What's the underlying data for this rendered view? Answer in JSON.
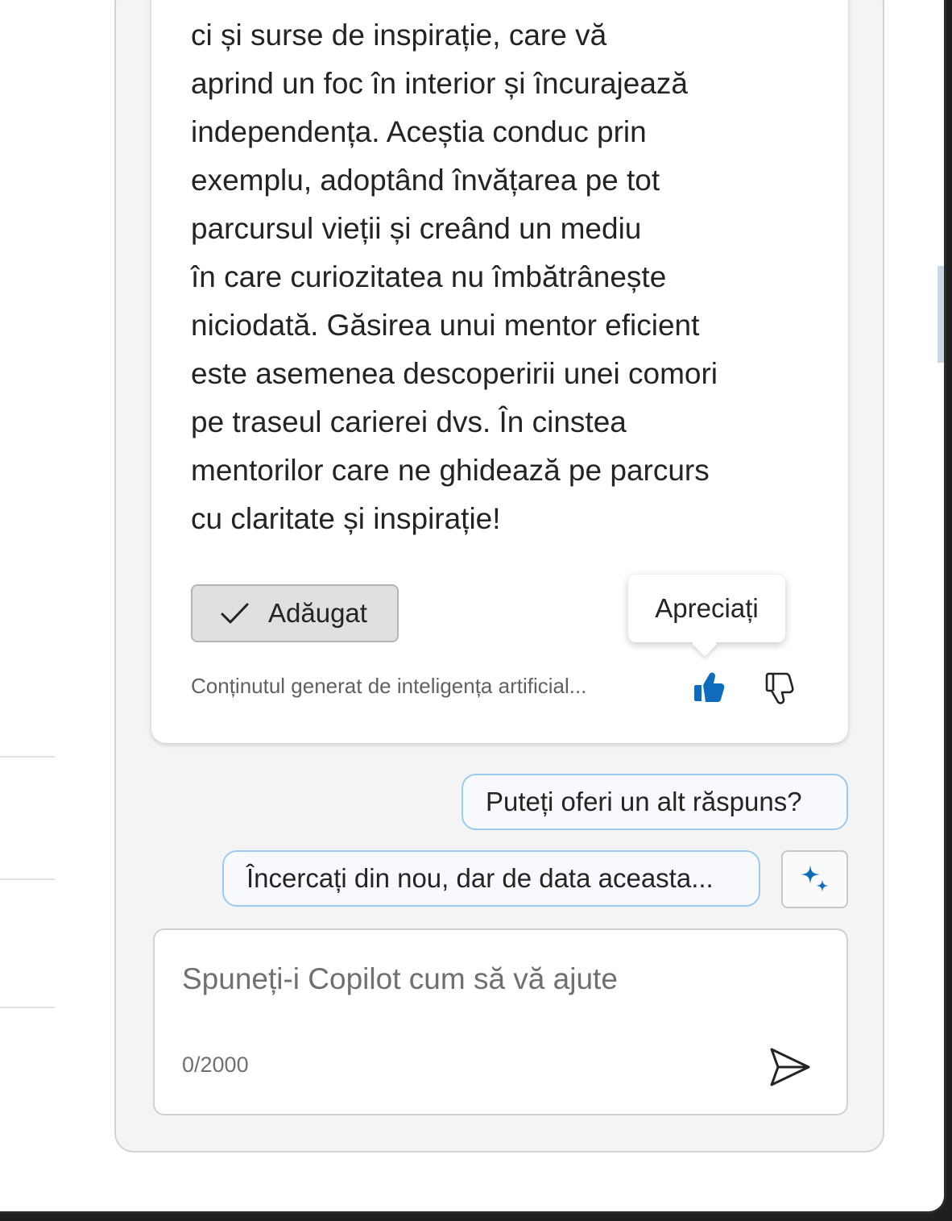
{
  "response": {
    "lines": [
      "ci și surse de inspirație, care vă",
      "aprind un foc în interior și încurajează",
      "independența. Aceștia conduc prin",
      "exemplu, adoptând învățarea pe tot",
      "parcursul vieții și creând un mediu",
      "în care curiozitatea nu îmbătrânește",
      "niciodată. Găsirea unui mentor eficient",
      "este asemenea descoperirii unei comori",
      "pe traseul carierei dvs. În cinstea",
      "mentorilor care ne ghidează pe parcurs",
      "cu claritate și inspirație!"
    ],
    "added_label": "Adăugat",
    "disclaimer": "Conținutul generat de inteligența artificial...",
    "tooltip": "Apreciați"
  },
  "suggestions": [
    "Puteți oferi un alt răspuns?",
    "Încercați din nou, dar de data aceasta..."
  ],
  "composer": {
    "placeholder": "Spuneți-i Copilot cum să vă ajute",
    "char_count": "0/2000"
  },
  "colors": {
    "accent": "#0f6cbd",
    "suggestion_border": "#9ccaf2"
  },
  "icons": {
    "added": "checkmark-icon",
    "like": "thumbs-up-icon",
    "dislike": "thumbs-down-icon",
    "sparkle": "sparkle-icon",
    "send": "send-icon"
  }
}
